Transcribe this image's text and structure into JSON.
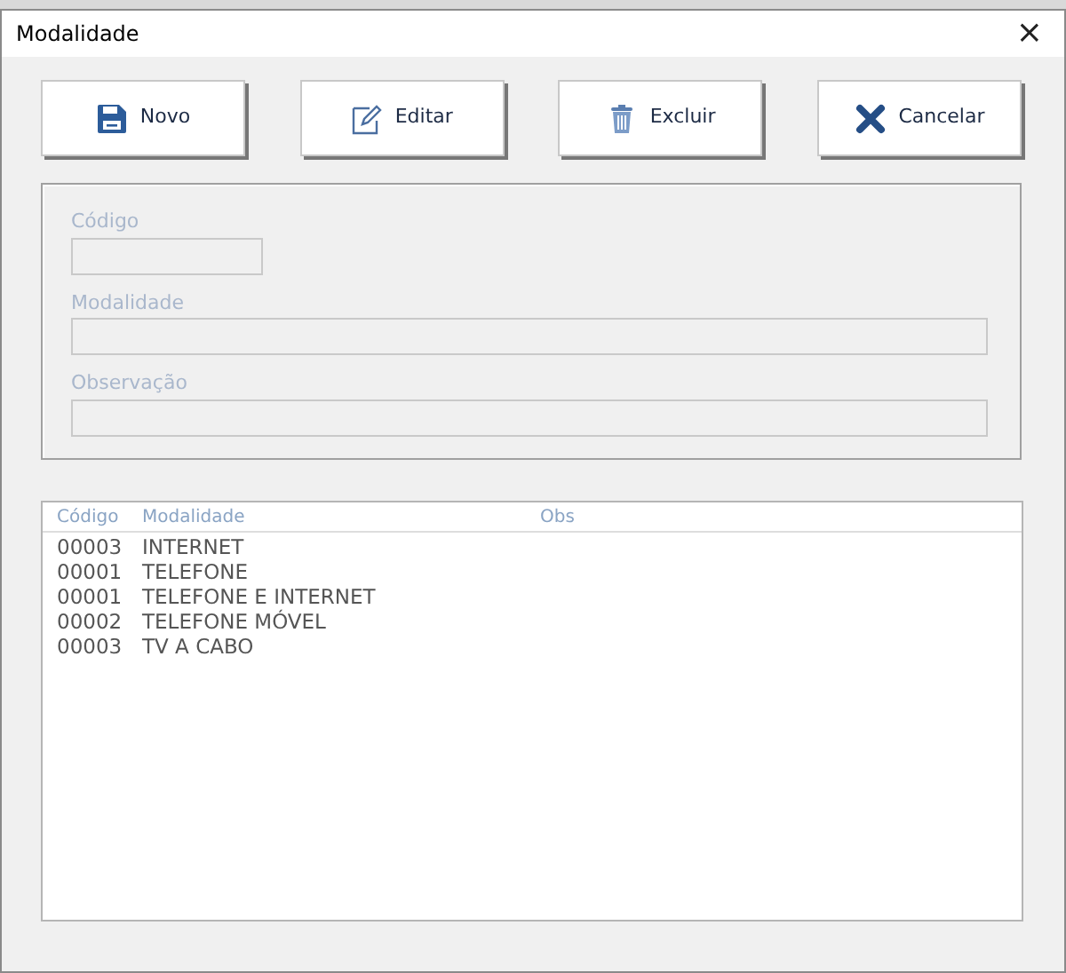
{
  "window": {
    "title": "Modalidade",
    "close": "×"
  },
  "buttons": [
    {
      "label": "Novo",
      "kind": "save"
    },
    {
      "label": "Editar",
      "kind": "edit"
    },
    {
      "label": "Excluir",
      "kind": "delete"
    },
    {
      "label": "Cancelar",
      "kind": "cancel"
    }
  ],
  "form": {
    "disabled": true,
    "fields": [
      {
        "label": "Código",
        "kind": "short"
      },
      {
        "label": "Modalidade",
        "kind": "long"
      },
      {
        "label": "Observação",
        "kind": "long"
      }
    ]
  },
  "table": {
    "columns": [
      "Código",
      "Modalidade",
      "Obs"
    ],
    "rows": [
      [
        "00003",
        "INTERNET"
      ],
      [
        "00001",
        "TELEFONE"
      ],
      [
        "00001",
        "TELEFONE E INTERNET"
      ],
      [
        "00002",
        "TELEFONE MÓVEL"
      ],
      [
        "00003",
        "TV A CABO"
      ]
    ]
  }
}
